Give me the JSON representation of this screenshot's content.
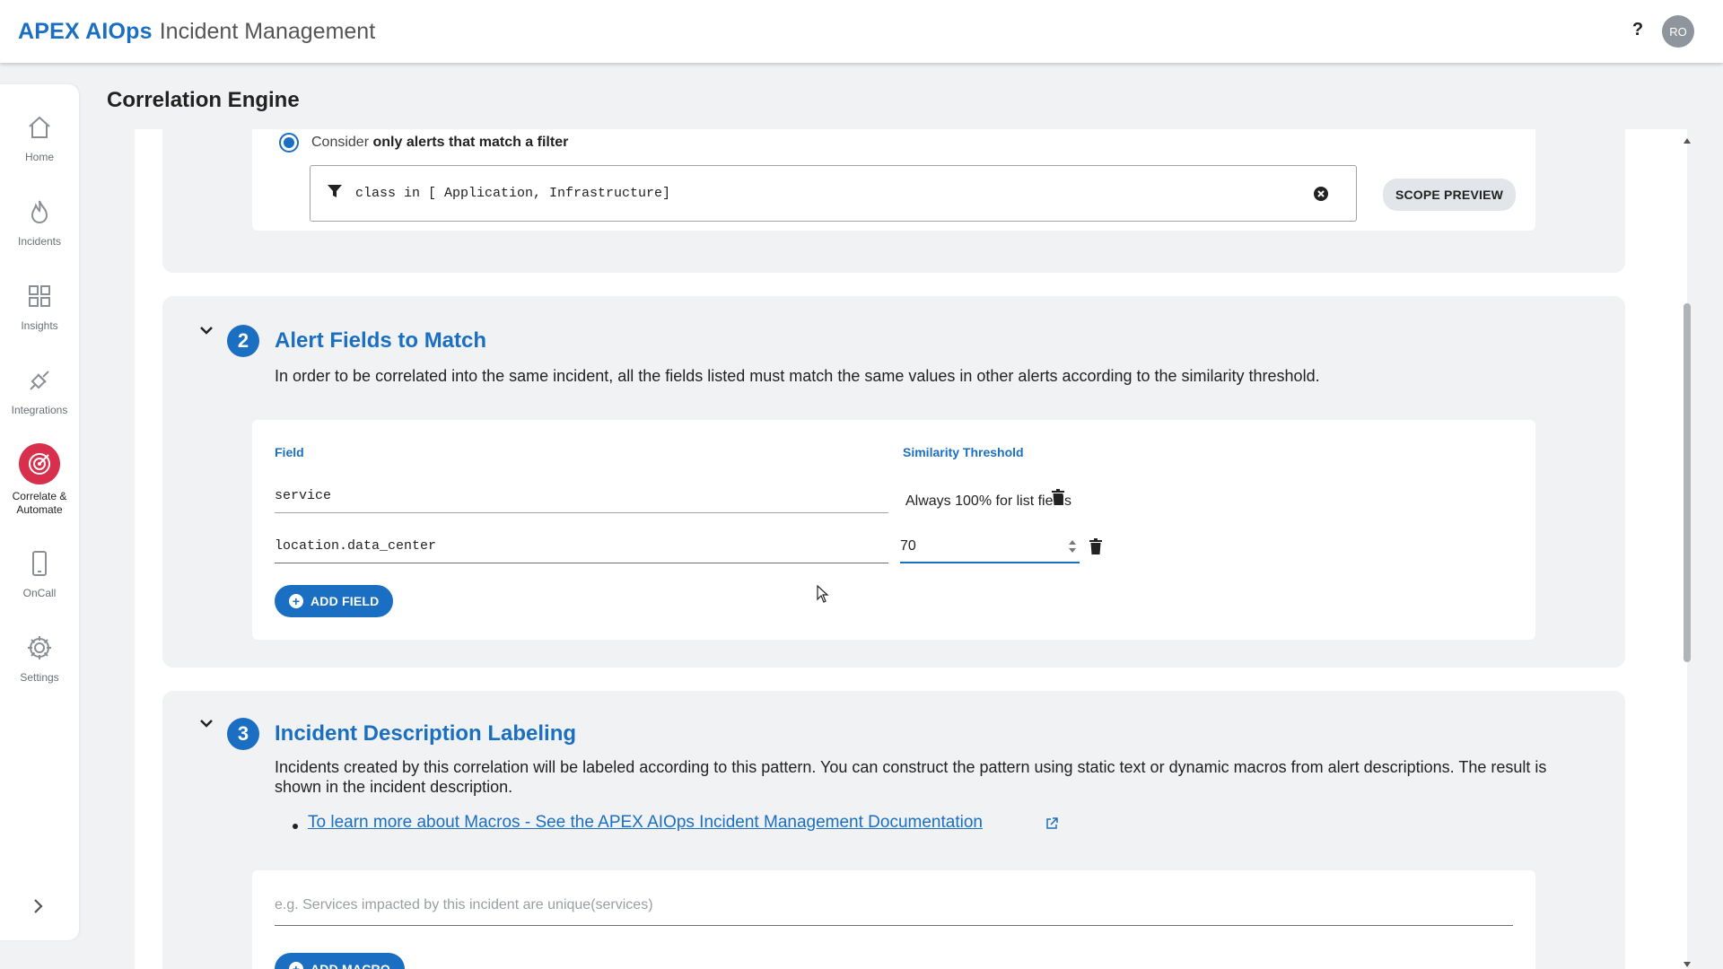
{
  "app": {
    "brand": "APEX AIOps",
    "brand_sub": "Incident Management",
    "help_label": "?",
    "avatar_initials": "RO"
  },
  "sidebar": {
    "items": [
      {
        "label": "Home",
        "icon": "home-icon"
      },
      {
        "label": "Incidents",
        "icon": "flame-icon"
      },
      {
        "label": "Insights",
        "icon": "grid-icon"
      },
      {
        "label": "Integrations",
        "icon": "plug-icon"
      },
      {
        "label": "Correlate & Automate",
        "icon": "target-icon",
        "active": true
      },
      {
        "label": "OnCall",
        "icon": "phone-icon"
      },
      {
        "label": "Settings",
        "icon": "gear-icon"
      }
    ],
    "expand_icon": "chevron-right-icon"
  },
  "page": {
    "title": "Correlation Engine"
  },
  "scope": {
    "radio_prefix": "Consider",
    "radio_bold": "only alerts that match a filter",
    "filter_value": "class in [ Application, Infrastructure]",
    "scope_preview_label": "SCOPE PREVIEW"
  },
  "fields_section": {
    "number": "2",
    "title": "Alert Fields to Match",
    "description": "In order to be correlated into the same incident, all the fields listed must match the same values in other alerts according to the similarity threshold.",
    "col_field": "Field",
    "col_threshold": "Similarity Threshold",
    "rows": [
      {
        "field": "service",
        "threshold": "Always 100% for list fields"
      },
      {
        "field": "location.data_center",
        "threshold": "70"
      }
    ],
    "add_field_label": "ADD FIELD"
  },
  "labeling_section": {
    "number": "3",
    "title": "Incident Description Labeling",
    "description": "Incidents created by this correlation will be labeled according to this pattern. You can construct the pattern using static text or dynamic macros from alert descriptions. The result is shown in the incident description.",
    "doc_link": "To learn more about Macros - See the APEX AIOps Incident Management Documentation",
    "input_placeholder": "e.g. Services impacted by this incident are unique(services)",
    "add_macro_label": "ADD MACRO"
  },
  "colors": {
    "accent": "#1a6fc2",
    "active_nav": "#d8304c",
    "background": "#f1f2f4"
  }
}
